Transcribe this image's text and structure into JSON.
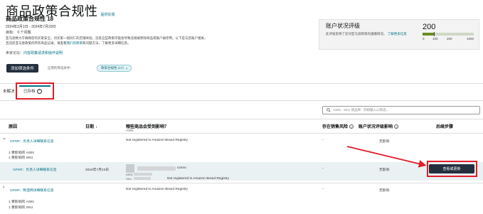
{
  "header": {
    "title": "商品政策合规性",
    "feedback": "提供反馈",
    "subtitle": "商品政策合规性 18",
    "date_range": "2024年2月1日 - 2024年7月29日",
    "goal": "目标： 0 个问题",
    "description_pre": "亚马逊致力于确保您的买家安全，对买家一视同仁的店铺体验。违反这些政策可能会导致违规被移除商品或账户被停用。以下是与您账户相关，",
    "description_line2_pre": "且违反亚马逊政策的所有商品记录。请查看",
    "description_link": "我们的政策",
    "description_post": "和问题方法，了解更多详细信息。",
    "forum_label": "卖家论坛：",
    "forum_link": "内容政策请求和操作说明"
  },
  "filters": {
    "add_button": "添加筛选条件",
    "applied_label": "应用的筛选条件：",
    "chip": "政策合规性 (17)",
    "chip_close": "×"
  },
  "account_health": {
    "title": "账户状况评级",
    "description": "此评级反映了您对亚马逊政策的遵循情况。",
    "link": "了解更多信息",
    "score": "200",
    "scale": [
      "0",
      "100",
      "200",
      "1000"
    ],
    "fill_fraction": 0.22,
    "colors": {
      "fill": "#6a8e23",
      "track": "#cfd8c6"
    }
  },
  "tabs": [
    {
      "label": "未解决"
    },
    {
      "label": "已存档"
    }
  ],
  "search": {
    "placeholder": "ASIN、SKU 或品牌 - 开始输入以筛选..."
  },
  "table": {
    "headers": {
      "reason": "原因",
      "date": "日期",
      "date_sort": "↓",
      "affected": "哪些商品会受到影响？",
      "affected_sub": "ASIN",
      "risk": "存在销售风险",
      "impact": "账户状况评级影响",
      "next": "后续步骤"
    },
    "groups": [
      {
        "reason": "GPSR：负责人详细联系信息",
        "affected": "Not registered in Amazon Brand Registry",
        "risk": "-",
        "impact": "无影响",
        "asin_count": "1 受影响的 ASIN",
        "sku_count": "1 受影响的 SKU",
        "child": {
          "reason": "GPSR：负责人详细联系信息",
          "date": "2024年7月23日",
          "product_name": "Uomo",
          "asin_label": "ASIN",
          "sku_label": "SKU",
          "affected": "Not registered in Amazon Brand Registry",
          "risk": "-",
          "impact": "无影响",
          "action": "查看或更新"
        }
      },
      {
        "reason": "GPSR：制造商详细联系信息",
        "affected": "Not registered in Amazon Brand Registry",
        "risk": "-",
        "impact": "无影响",
        "asin_count": "1 受影响的 ASIN",
        "sku_count": "1 受影响的 SKU"
      }
    ]
  }
}
